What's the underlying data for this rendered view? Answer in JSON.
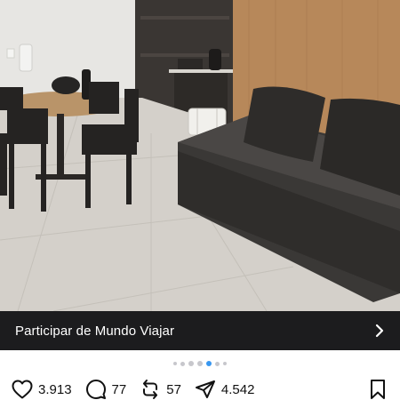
{
  "photo": {
    "icon": "room-photo",
    "description_hidden": true
  },
  "cta": {
    "label": "Participar de Mundo Viajar",
    "icon": "chevron-right-icon"
  },
  "carousel": {
    "total": 7,
    "active_index": 4
  },
  "actions": {
    "likes": "3.913",
    "comments": "77",
    "reposts": "57",
    "shares": "4.542"
  },
  "colors": {
    "accent": "#3897f0",
    "banner": "#1c1c1e"
  }
}
